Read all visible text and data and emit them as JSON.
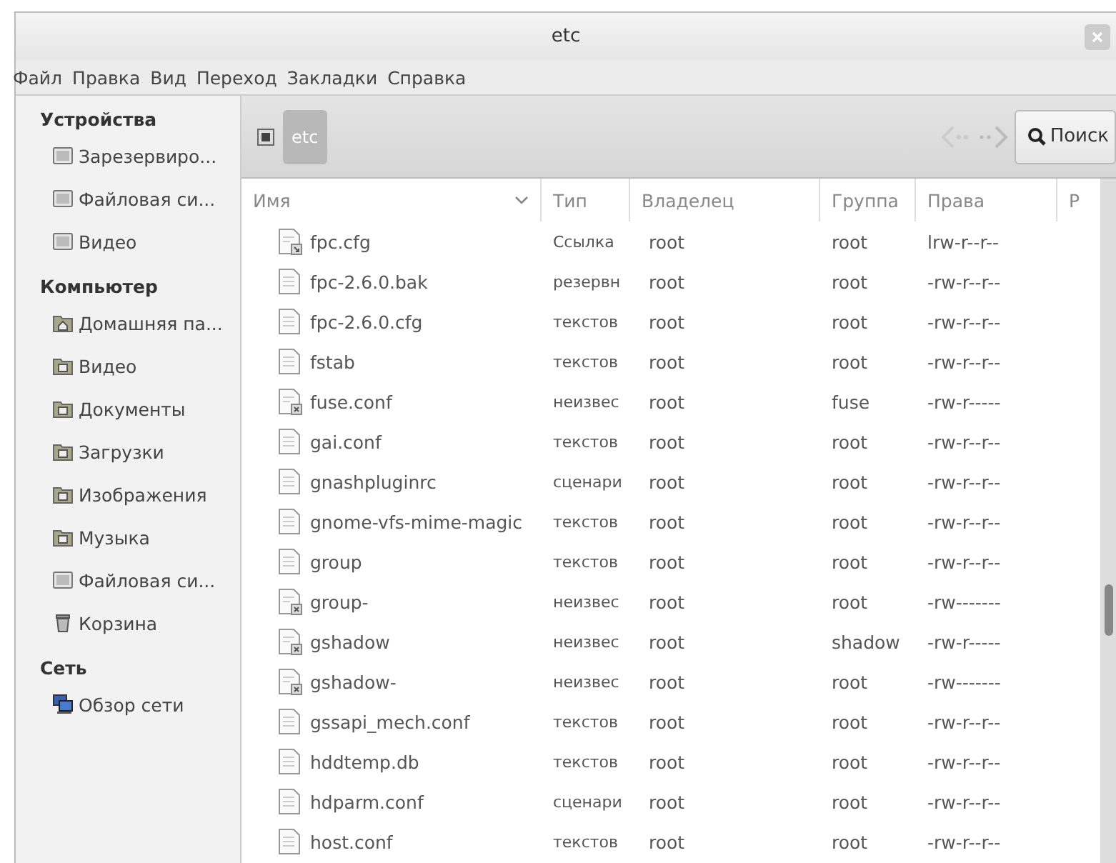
{
  "window": {
    "title": "etc"
  },
  "menu": [
    "Файл",
    "Правка",
    "Вид",
    "Переход",
    "Закладки",
    "Справка"
  ],
  "sidebar": {
    "sections": [
      {
        "title": "Устройства",
        "items": [
          {
            "label": "Зарезервиро...",
            "kind": "drive"
          },
          {
            "label": "Файловая си...",
            "kind": "drive"
          },
          {
            "label": "Видео",
            "kind": "drive"
          }
        ]
      },
      {
        "title": "Компьютер",
        "items": [
          {
            "label": "Домашняя па...",
            "kind": "home"
          },
          {
            "label": "Видео",
            "kind": "folder"
          },
          {
            "label": "Документы",
            "kind": "folder"
          },
          {
            "label": "Загрузки",
            "kind": "folder"
          },
          {
            "label": "Изображения",
            "kind": "folder"
          },
          {
            "label": "Музыка",
            "kind": "folder"
          },
          {
            "label": "Файловая си...",
            "kind": "drive"
          },
          {
            "label": "Корзина",
            "kind": "trash"
          }
        ]
      },
      {
        "title": "Сеть",
        "items": [
          {
            "label": "Обзор сети",
            "kind": "network"
          }
        ]
      }
    ]
  },
  "path_bar": {
    "crumbs": [
      {
        "label": "etc",
        "selected": true
      }
    ]
  },
  "search_button": "Поиск",
  "table": {
    "columns": [
      "Имя",
      "Тип",
      "Владелец",
      "Группа",
      "Права",
      "Р"
    ],
    "rows": [
      {
        "kind": "link",
        "cells": [
          "fpc.cfg",
          "Ссылка",
          "root",
          "root",
          "lrw-r--r--"
        ]
      },
      {
        "kind": "text",
        "cells": [
          "fpc-2.6.0.bak",
          "резервн",
          "root",
          "root",
          "-rw-r--r--"
        ]
      },
      {
        "kind": "text",
        "cells": [
          "fpc-2.6.0.cfg",
          "текстов",
          "root",
          "root",
          "-rw-r--r--"
        ]
      },
      {
        "kind": "text",
        "cells": [
          "fstab",
          "текстов",
          "root",
          "root",
          "-rw-r--r--"
        ]
      },
      {
        "kind": "unknown",
        "cells": [
          "fuse.conf",
          "неизвес",
          "root",
          "fuse",
          "-rw-r-----"
        ]
      },
      {
        "kind": "text",
        "cells": [
          "gai.conf",
          "текстов",
          "root",
          "root",
          "-rw-r--r--"
        ]
      },
      {
        "kind": "text",
        "cells": [
          "gnashpluginrc",
          "сценари",
          "root",
          "root",
          "-rw-r--r--"
        ]
      },
      {
        "kind": "text",
        "cells": [
          "gnome-vfs-mime-magic",
          "текстов",
          "root",
          "root",
          "-rw-r--r--"
        ]
      },
      {
        "kind": "text",
        "cells": [
          "group",
          "текстов",
          "root",
          "root",
          "-rw-r--r--"
        ]
      },
      {
        "kind": "unknown",
        "cells": [
          "group-",
          "неизвес",
          "root",
          "root",
          "-rw-------"
        ]
      },
      {
        "kind": "unknown",
        "cells": [
          "gshadow",
          "неизвес",
          "root",
          "shadow",
          "-rw-r-----"
        ]
      },
      {
        "kind": "unknown",
        "cells": [
          "gshadow-",
          "неизвес",
          "root",
          "root",
          "-rw-------"
        ]
      },
      {
        "kind": "text",
        "cells": [
          "gssapi_mech.conf",
          "текстов",
          "root",
          "root",
          "-rw-r--r--"
        ]
      },
      {
        "kind": "text",
        "cells": [
          "hddtemp.db",
          "текстов",
          "root",
          "root",
          "-rw-r--r--"
        ]
      },
      {
        "kind": "text",
        "cells": [
          "hdparm.conf",
          "сценари",
          "root",
          "root",
          "-rw-r--r--"
        ]
      },
      {
        "kind": "text",
        "cells": [
          "host.conf",
          "текстов",
          "root",
          "root",
          "-rw-r--r--"
        ]
      }
    ]
  }
}
